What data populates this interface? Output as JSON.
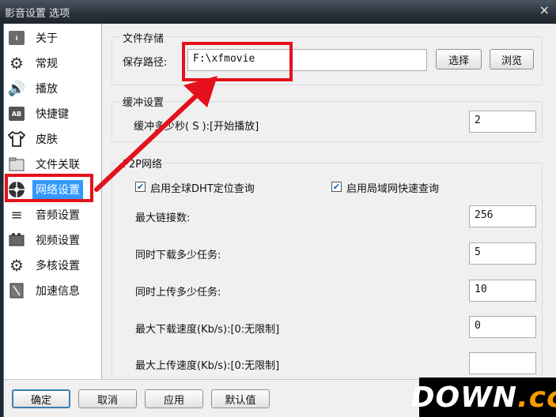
{
  "window": {
    "title": "影音设置 选项",
    "close_icon": "×"
  },
  "sidebar": {
    "items": [
      {
        "label": "关于",
        "icon": "info-icon"
      },
      {
        "label": "常规",
        "icon": "gear-icon"
      },
      {
        "label": "播放",
        "icon": "speaker-icon"
      },
      {
        "label": "快捷键",
        "icon": "keyboard-icon"
      },
      {
        "label": "皮肤",
        "icon": "tshirt-icon"
      },
      {
        "label": "文件关联",
        "icon": "folder-icon"
      },
      {
        "label": "网络设置",
        "icon": "network-icon",
        "selected": true
      },
      {
        "label": "音频设置",
        "icon": "audio-icon"
      },
      {
        "label": "视频设置",
        "icon": "video-icon"
      },
      {
        "label": "多核设置",
        "icon": "multicore-icon"
      },
      {
        "label": "加速信息",
        "icon": "accelerate-icon"
      }
    ]
  },
  "file_storage": {
    "title": "文件存储",
    "path_label": "保存路径:",
    "path_value": "F:\\xfmovie",
    "select_button": "选择",
    "browse_button": "浏览"
  },
  "buffer": {
    "title": "缓冲设置",
    "label": "缓冲多少秒( S ):[开始播放]",
    "value": "2"
  },
  "p2p": {
    "title": "P2P网络",
    "dht_label": "启用全球DHT定位查询",
    "dht_checked": true,
    "lan_label": "启用局域网快速查询",
    "lan_checked": true,
    "max_links_label": "最大链接数:",
    "max_links_value": "256",
    "download_tasks_label": "同时下载多少任务:",
    "download_tasks_value": "5",
    "upload_tasks_label": "同时上传多少任务:",
    "upload_tasks_value": "10",
    "max_download_label": "最大下载速度(Kb/s):[0:无限制]",
    "max_download_value": "0",
    "max_upload_label": "最大上传速度(Kb/s):[0:无限制]",
    "max_upload_value": ""
  },
  "footer": {
    "ok": "确定",
    "cancel": "取消",
    "apply": "应用",
    "default": "默认值"
  },
  "watermark": {
    "down": "DOWN",
    "dot": ".",
    "cc": "cc"
  },
  "colors": {
    "highlight": "#e4101b",
    "selection": "#3399ff"
  }
}
